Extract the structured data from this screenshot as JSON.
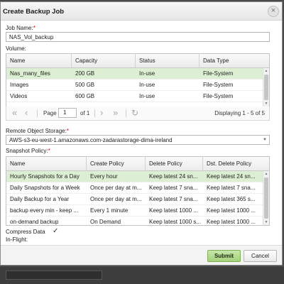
{
  "dialog": {
    "title": "Create Backup Job",
    "close_glyph": "×"
  },
  "job_name": {
    "label": "Job Name:",
    "required_mark": "*",
    "value": "NAS_Vol_backup"
  },
  "volume": {
    "label": "Volume:",
    "columns": [
      "Name",
      "Capacity",
      "Status",
      "Data Type"
    ],
    "rows": [
      {
        "name": "Nas_many_files",
        "capacity": "200 GB",
        "status": "In-use",
        "data_type": "File-System",
        "selected": true
      },
      {
        "name": "Images",
        "capacity": "500 GB",
        "status": "In-use",
        "data_type": "File-System",
        "selected": false
      },
      {
        "name": "Videos",
        "capacity": "600 GB",
        "status": "In-use",
        "data_type": "File-System",
        "selected": false
      }
    ]
  },
  "pager": {
    "page_label": "Page",
    "page_value": "1",
    "of_label": "of 1",
    "display_text": "Displaying 1 - 5 of 5",
    "icons": [
      "first-page-icon",
      "prev-page-icon",
      "next-page-icon",
      "last-page-icon",
      "refresh-icon"
    ]
  },
  "remote_storage": {
    "label": "Remote Object Storage:",
    "required_mark": "*",
    "value": "AWS-s3-eu-west-1.amazonaws.com-zadarastorage-dima-ireland"
  },
  "snapshot_policy": {
    "label": "Snapshot Policy:",
    "required_mark": "*",
    "columns": [
      "Name",
      "Create Policy",
      "Delete Policy",
      "Dst. Delete Policy"
    ],
    "rows": [
      {
        "name": "Hourly Snapshots for a Day",
        "create": "Every hour",
        "delete": "Keep latest 24 sn...",
        "dst_delete": "Keep latest 24 sn...",
        "selected": true
      },
      {
        "name": "Daily Snapshots for a Week",
        "create": "Once per day at m...",
        "delete": "Keep latest 7 sna...",
        "dst_delete": "Keep latest 7 sna...",
        "selected": false
      },
      {
        "name": "Daily Backup for a Year",
        "create": "Once per day at m...",
        "delete": "Keep latest 7 sna...",
        "dst_delete": "Keep latest 365 s...",
        "selected": false
      },
      {
        "name": "backup every min - keep ...",
        "create": "Every 1 minute",
        "delete": "Keep latest 1000 ...",
        "dst_delete": "Keep latest 1000 ...",
        "selected": false
      },
      {
        "name": "on-demand backup",
        "create": "On Demand",
        "delete": "Keep latest 1000 s...",
        "dst_delete": "Keep latest 1000 ...",
        "selected": false
      }
    ]
  },
  "compress": {
    "label_line1": "Compress Data",
    "label_line2": "In-Flight:",
    "checked": true,
    "check_glyph": "✓"
  },
  "footer": {
    "submit_label": "Submit",
    "cancel_label": "Cancel"
  },
  "colors": {
    "selected_row": "#dcefd2",
    "submit_button": "#a4d27b",
    "required": "#d40000"
  }
}
